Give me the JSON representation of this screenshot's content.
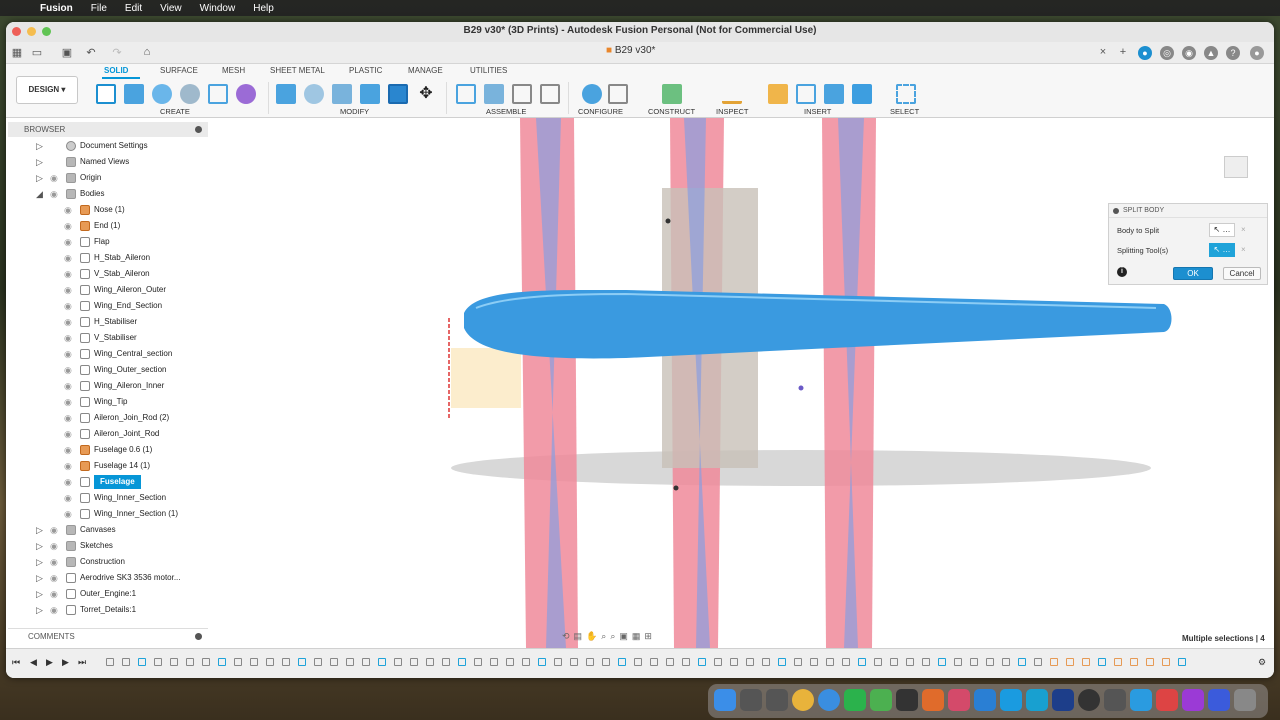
{
  "macmenu": {
    "app": "Fusion",
    "items": [
      "File",
      "Edit",
      "View",
      "Window",
      "Help"
    ]
  },
  "window": {
    "title": "B29 v30* (3D Prints) - Autodesk Fusion Personal (Not for Commercial Use)",
    "doc_tab": "B29 v30*"
  },
  "toolbar": {
    "workspace": "DESIGN",
    "tabs": [
      "SOLID",
      "SURFACE",
      "MESH",
      "SHEET METAL",
      "PLASTIC",
      "MANAGE",
      "UTILITIES"
    ],
    "groups": [
      "CREATE",
      "MODIFY",
      "ASSEMBLE",
      "CONFIGURE",
      "CONSTRUCT",
      "INSPECT",
      "INSERT",
      "SELECT"
    ]
  },
  "browser": {
    "title": "BROWSER",
    "top_items": [
      "Document Settings",
      "Named Views",
      "Origin",
      "Bodies"
    ],
    "bodies": [
      "Nose (1)",
      "End (1)",
      "Flap",
      "H_Stab_Aileron",
      "V_Stab_Aileron",
      "Wing_Aileron_Outer",
      "Wing_End_Section",
      "H_Stabiliser",
      "V_Stabiliser",
      "Wing_Central_section",
      "Wing_Outer_section",
      "Wing_Aileron_Inner",
      "Wing_Tip",
      "Aileron_Join_Rod (2)",
      "Aileron_Joint_Rod",
      "Fuselage 0.6 (1)",
      "Fuselage 14 (1)",
      "Fuselage",
      "Wing_Inner_Section",
      "Wing_Inner_Section (1)"
    ],
    "selected": "Fuselage",
    "bottom_items": [
      "Canvases",
      "Sketches",
      "Construction",
      "Aerodrive SK3 3536 motor...",
      "Outer_Engine:1",
      "Torret_Details:1"
    ]
  },
  "comments": {
    "title": "COMMENTS"
  },
  "split_body": {
    "title": "SPLIT BODY",
    "body_to_split_label": "Body to Split",
    "splitting_tools_label": "Splitting Tool(s)",
    "ok": "OK",
    "cancel": "Cancel"
  },
  "status": {
    "text": "Multiple selections | 4"
  },
  "colors": {
    "accent": "#0696d7",
    "fuselage": "#3a9ae0",
    "plane_red": "#f08a9a",
    "plane_blue": "#8a9ee0"
  }
}
